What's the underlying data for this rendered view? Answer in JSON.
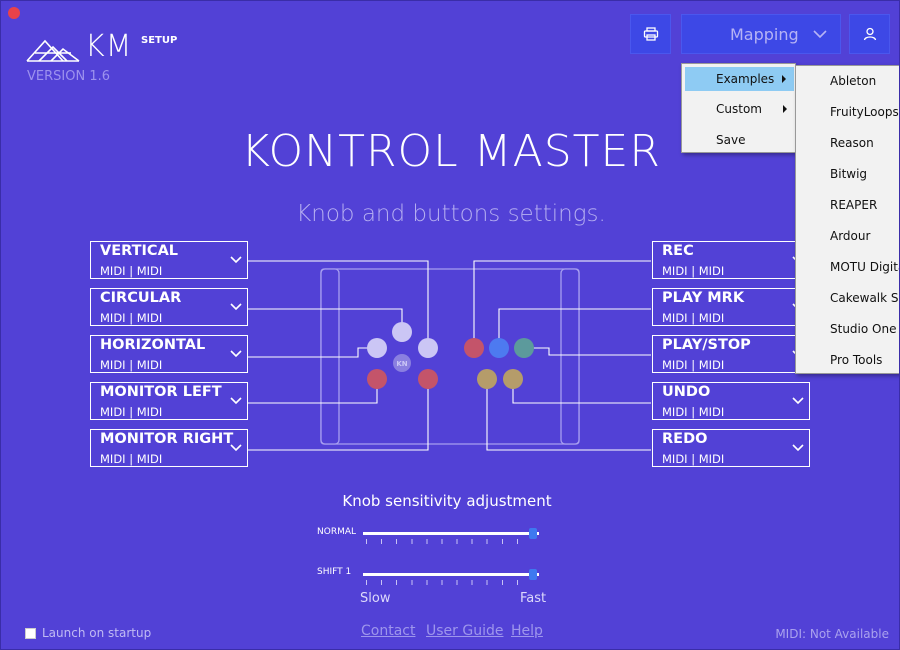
{
  "app": {
    "logo_text": "KM",
    "logo_sup": "SETUP",
    "version": "VERSION 1.6",
    "title": "KONTROL MASTER",
    "subtitle": "Knob and buttons settings."
  },
  "toolbar": {
    "mapping_label": "Mapping"
  },
  "controls_left": [
    {
      "name": "VERTICAL",
      "midi": "MIDI | MIDI"
    },
    {
      "name": "CIRCULAR",
      "midi": "MIDI | MIDI"
    },
    {
      "name": "HORIZONTAL",
      "midi": "MIDI | MIDI"
    },
    {
      "name": "MONITOR LEFT",
      "midi": "MIDI | MIDI"
    },
    {
      "name": "MONITOR RIGHT",
      "midi": "MIDI | MIDI"
    }
  ],
  "controls_right": [
    {
      "name": "REC",
      "midi": "MIDI | MIDI"
    },
    {
      "name": "PLAY MRK",
      "midi": "MIDI | MIDI"
    },
    {
      "name": "PLAY/STOP",
      "midi": "MIDI | MIDI"
    },
    {
      "name": "UNDO",
      "midi": "MIDI | MIDI"
    },
    {
      "name": "REDO",
      "midi": "MIDI | MIDI"
    }
  ],
  "device": {
    "center_label": "KN"
  },
  "colors": {
    "background": "#5241d6",
    "button_blue": "#3d48e6",
    "knob_light": "#cbc6f5",
    "knob_red": "#c4546a",
    "knob_blue": "#4d7af0",
    "knob_teal": "#5c9a9c",
    "knob_gold": "#b59c6a",
    "menu_highlight": "#8ecbf3"
  },
  "sensitivity": {
    "title": "Knob sensitivity adjustment",
    "sliders": [
      {
        "label": "NORMAL",
        "value": 1.0
      },
      {
        "label": "SHIFT 1",
        "value": 1.0
      }
    ],
    "min_label": "Slow",
    "max_label": "Fast"
  },
  "footer": {
    "launch_label": "Launch on startup",
    "launch_checked": false,
    "links": [
      "Contact",
      "User Guide",
      "Help"
    ],
    "midi_status": "MIDI: Not Available"
  },
  "menu": {
    "items": [
      {
        "label": "Examples",
        "has_submenu": true,
        "highlighted": true
      },
      {
        "label": "Custom",
        "has_submenu": true,
        "highlighted": false
      },
      {
        "label": "Save",
        "has_submenu": false,
        "highlighted": false
      }
    ],
    "submenu_items": [
      "Ableton",
      "FruityLoops",
      "Reason",
      "Bitwig",
      "REAPER",
      "Ardour",
      "MOTU Digital",
      "Cakewalk Sonar",
      "Studio One",
      "Pro Tools"
    ]
  },
  "icons": {
    "close": "close-dot-icon",
    "printer": "printer-icon",
    "chevron": "chevron-down-icon",
    "user": "user-icon",
    "submenu_arrow": "triangle-right-icon"
  }
}
